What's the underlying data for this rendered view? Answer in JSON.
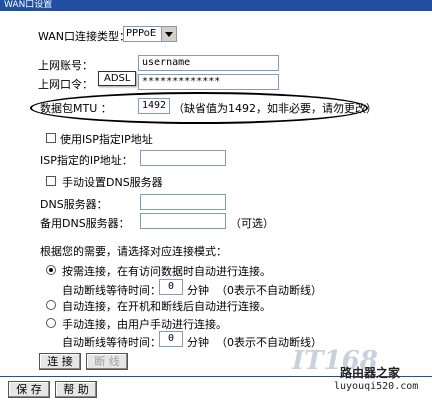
{
  "window": {
    "title": "WAN口设置"
  },
  "connection_type": {
    "label": "WAN口连接类型：",
    "value": "PPPoE"
  },
  "account": {
    "label": "上网账号：",
    "value": "username"
  },
  "password": {
    "label": "上网口令：",
    "value": "*************"
  },
  "tooltip": {
    "text": "ADSL"
  },
  "mtu": {
    "label": "数据包MTU ：",
    "value": "1492",
    "hint": "（缺省值为1492，如非必要，请勿更改）"
  },
  "isp_ip": {
    "checkbox_label": "使用ISP指定IP地址",
    "field_label": "ISP指定的IP地址：",
    "value": ""
  },
  "dns_manual": {
    "checkbox_label": "手动设置DNS服务器"
  },
  "dns_primary": {
    "label": "DNS服务器：",
    "value": ""
  },
  "dns_secondary": {
    "label": "备用DNS服务器：",
    "value": "",
    "hint": "（可选）"
  },
  "mode_prompt": "根据您的需要，请选择对应连接模式：",
  "modes": [
    {
      "label": "按需连接，在有访问数据时自动进行连接。",
      "checked": true
    },
    {
      "label": "自动连接，在开机和断线后自动进行连接。",
      "checked": false
    },
    {
      "label": "手动连接，由用户手动进行连接。",
      "checked": false
    }
  ],
  "idle_1": {
    "prefix": "自动断线等待时间：",
    "value": "0",
    "unit": "分钟",
    "note": "（0表示不自动断线）"
  },
  "idle_2": {
    "prefix": "自动断线等待时间：",
    "value": "0",
    "unit": "分钟",
    "note": "（0表示不自动断线）"
  },
  "buttons": {
    "connect": "连 接",
    "disconnect": "断 线",
    "save": "保 存",
    "help": "帮 助"
  },
  "watermark": {
    "logo": "IT168",
    "cn_name": "路由器之家",
    "url": "luyouqi520.com"
  }
}
